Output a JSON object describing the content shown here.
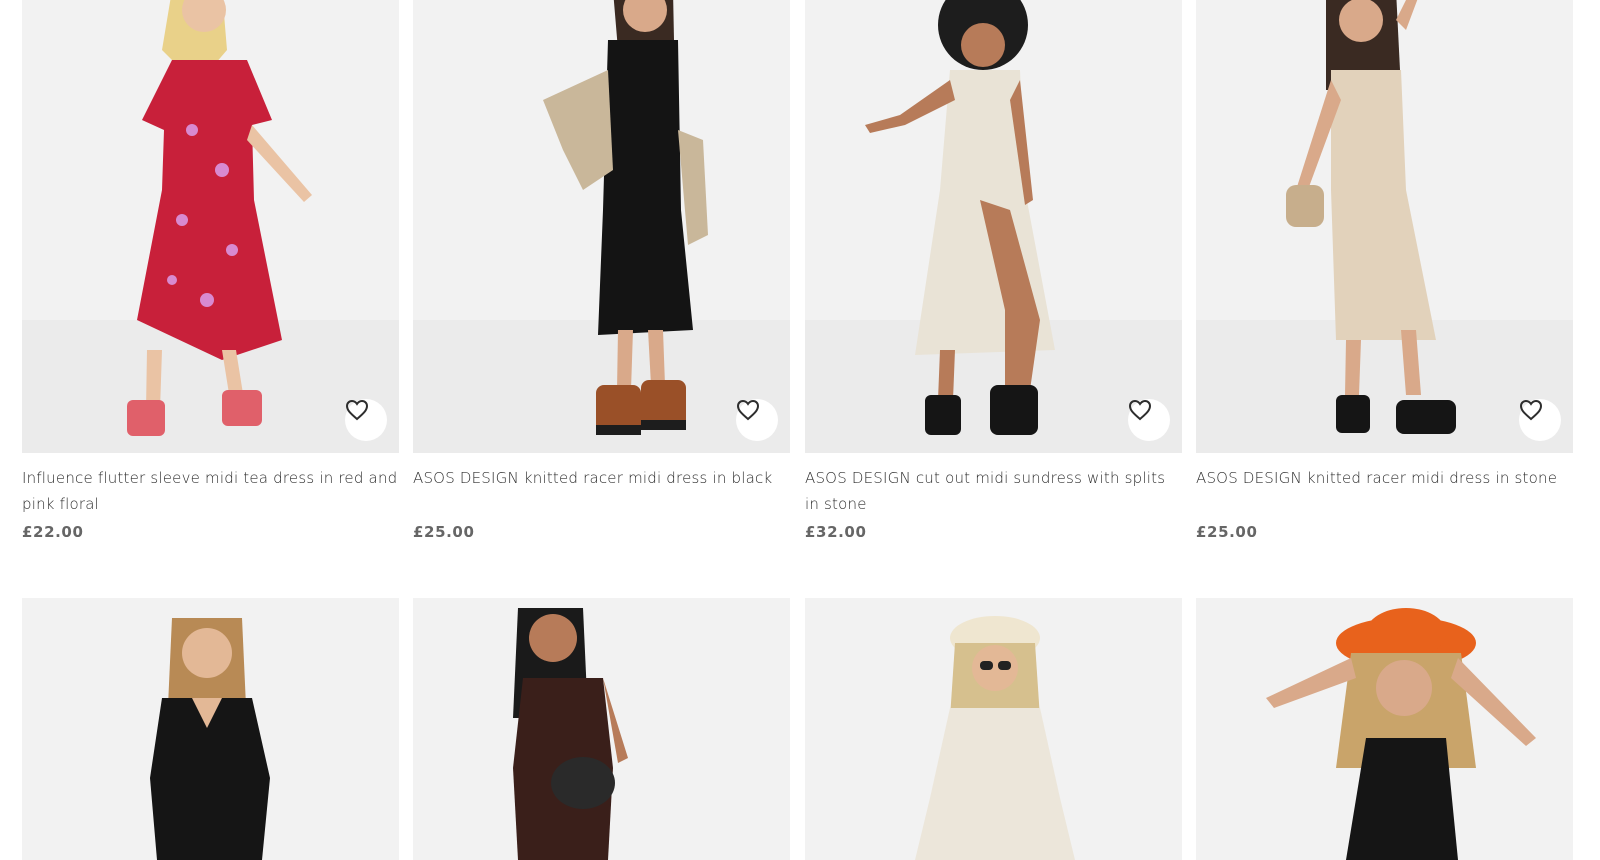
{
  "products": [
    {
      "title": "Influence flutter sleeve midi tea dress in red and pink floral",
      "price": "£22.00",
      "dress_color": "#c8203a",
      "accent_color": "#d88ad0",
      "shoe_color": "#e0606a"
    },
    {
      "title": "ASOS DESIGN knitted racer midi dress in black",
      "price": "£25.00",
      "dress_color": "#141414",
      "accent_color": "#c9b79a",
      "shoe_color": "#9a5028"
    },
    {
      "title": "ASOS DESIGN cut out midi sundress with splits in stone",
      "price": "£32.00",
      "dress_color": "#e9e3d6",
      "accent_color": "#e9e3d6",
      "shoe_color": "#151515"
    },
    {
      "title": "ASOS DESIGN knitted racer midi dress in stone",
      "price": "£25.00",
      "dress_color": "#e2d2bb",
      "accent_color": "#c7ae8c",
      "shoe_color": "#151515"
    },
    {
      "dress_color": "#151515",
      "hair_color": "#b88a55"
    },
    {
      "dress_color": "#3a1f1a",
      "hair_color": "#1a1a1a"
    },
    {
      "dress_color": "#ece6da",
      "hair_color": "#d6c08e",
      "hat_color": "#efe6d0"
    },
    {
      "dress_color": "#151515",
      "hair_color": "#c9a46a",
      "hat_color": "#e8621c"
    }
  ],
  "icons": {
    "save": "heart-outline-icon"
  }
}
